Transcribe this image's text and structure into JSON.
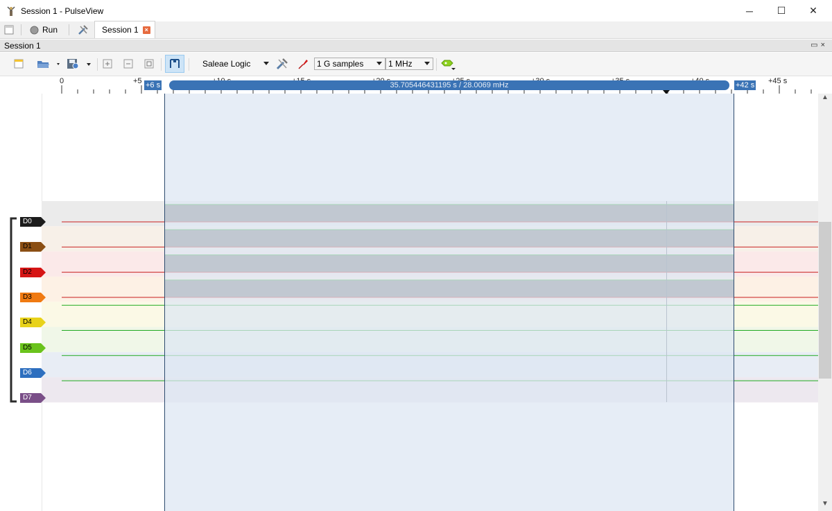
{
  "window": {
    "title": "Session 1 - PulseView",
    "minimize": "─",
    "maximize": "☐",
    "close": "✕"
  },
  "tabs": {
    "run_label": "Run",
    "session_tab": "Session 1",
    "close_glyph": "×"
  },
  "session": {
    "title": "Session 1",
    "float_icon": "▭",
    "close_icon": "×"
  },
  "toolbar": {
    "device": "Saleae Logic",
    "samples": "1 G samples",
    "rate": "1 MHz",
    "icons": [
      "new-session-icon",
      "open-icon",
      "save-icon",
      "zoom-in-icon",
      "zoom-out-icon",
      "zoom-fit-icon",
      "cursor-icon",
      "device-config-icon",
      "probe-icon",
      "decoder-icon"
    ]
  },
  "ruler": {
    "ticks": [
      "0",
      "+5",
      "+10 s",
      "+15 s",
      "+20 s",
      "+25 s",
      "+30 s",
      "+35 s",
      "+40 s",
      "+45 s"
    ],
    "cursor_left": "+6 s",
    "cursor_right": "+42 s",
    "range_text": "35.705446431195 s / 28.0069 mHz"
  },
  "channels": [
    {
      "name": "D0",
      "color": "#1c1c1c",
      "bg": "#ebebeb",
      "activity": true
    },
    {
      "name": "D1",
      "color": "#8b4f14",
      "bg": "#f7f0e8",
      "activity": true
    },
    {
      "name": "D2",
      "color": "#d61515",
      "bg": "#fbe9e9",
      "activity": true
    },
    {
      "name": "D3",
      "color": "#f07a12",
      "bg": "#fdf1e5",
      "activity": true
    },
    {
      "name": "D4",
      "color": "#e8d21a",
      "bg": "#fbf9e6",
      "activity": false
    },
    {
      "name": "D5",
      "color": "#6ac31c",
      "bg": "#f0f7e8",
      "activity": false
    },
    {
      "name": "D6",
      "color": "#2d6fbf",
      "bg": "#e8edf5",
      "activity": false
    },
    {
      "name": "D7",
      "color": "#7a4f88",
      "bg": "#ede8ef",
      "activity": false
    }
  ],
  "colors": {
    "selection": "#dce6f2",
    "accent": "#3a73b5",
    "high_line": "#1faa1f",
    "low_line": "#c81e1e",
    "activity_fill": "#7c7c7c"
  }
}
